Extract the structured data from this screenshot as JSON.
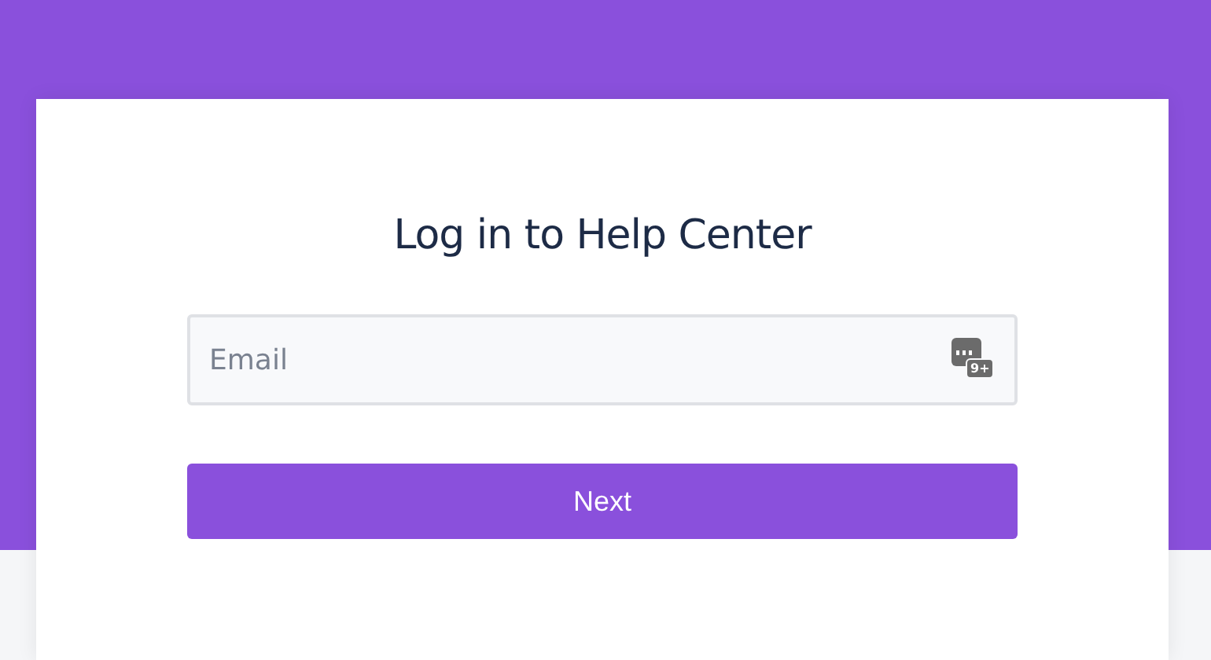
{
  "title": "Log in to Help Center",
  "email_field": {
    "placeholder": "Email",
    "autofill_badge": "9+"
  },
  "next_button": {
    "label": "Next"
  }
}
